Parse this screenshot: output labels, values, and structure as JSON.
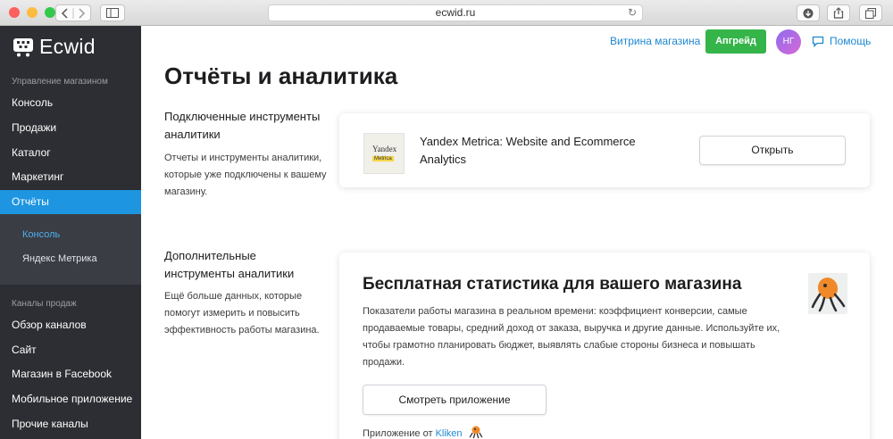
{
  "browser": {
    "url": "ecwid.ru",
    "colors": {
      "close": "#fc605c",
      "minimize": "#fdbc40",
      "zoom": "#34c84a"
    }
  },
  "sidebar": {
    "logo": "Ecwid",
    "store_section_label": "Управление магазином",
    "items": [
      {
        "label": "Консоль"
      },
      {
        "label": "Продажи"
      },
      {
        "label": "Каталог"
      },
      {
        "label": "Маркетинг"
      },
      {
        "label": "Отчёты",
        "active": true
      }
    ],
    "submenu": [
      {
        "label": "Консоль",
        "active": true
      },
      {
        "label": "Яндекс Метрика"
      }
    ],
    "channels_section_label": "Каналы продаж",
    "channel_items": [
      {
        "label": "Обзор каналов"
      },
      {
        "label": "Сайт"
      },
      {
        "label": "Магазин в Facebook"
      },
      {
        "label": "Мобильное приложение"
      },
      {
        "label": "Прочие каналы"
      }
    ]
  },
  "topbar": {
    "storefront_link": "Витрина магазина",
    "upgrade_label": "Апгрейд",
    "avatar_initials": "НГ",
    "help_label": "Помощь"
  },
  "main": {
    "title": "Отчёты и аналитика",
    "connected": {
      "heading": "Подключенные инструменты аналитики",
      "description": "Отчеты и инструменты аналитики, которые уже подключены к вашему магазину.",
      "app": {
        "icon_text_top": "Yandex",
        "icon_text_bottom": "Metrica",
        "name": "Yandex Metrica: Website and Ecommerce Analytics",
        "open_label": "Открыть"
      }
    },
    "additional": {
      "heading": "Дополнительные инструменты аналитики",
      "description": "Ещё больше данных, которые помогут измерить и повысить эффективность работы магазина.",
      "card": {
        "title": "Бесплатная статистика для вашего магазина",
        "text": "Показатели работы магазина в реальном времени: коэффициент конверсии, самые продаваемые товары, средний доход от заказа, выручка и другие данные. Используйте их, чтобы грамотно планировать бюджет, выявлять слабые стороны бизнеса и повышать продажи.",
        "view_label": "Смотреть приложение",
        "by_prefix": "Приложение от",
        "vendor": "Kliken"
      }
    }
  }
}
